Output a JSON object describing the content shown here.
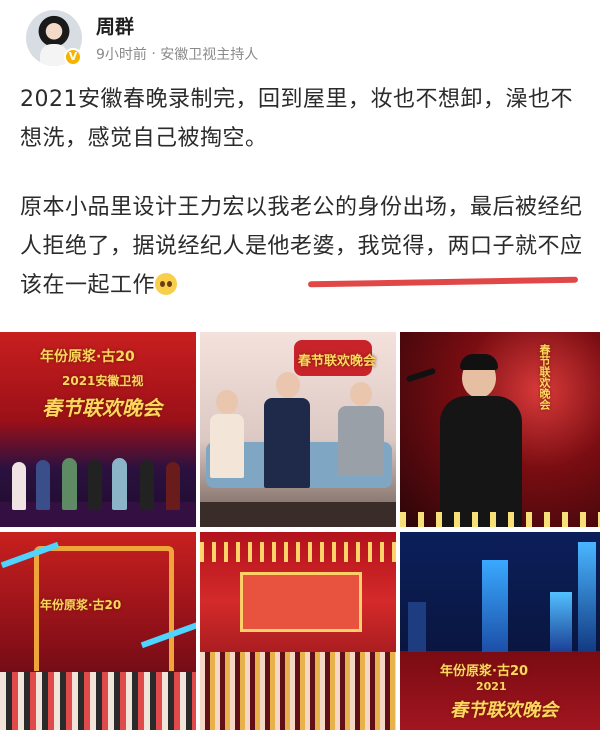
{
  "author": {
    "name": "周群",
    "time": "9小时前",
    "separator": "·",
    "source": "安徽卫视主持人",
    "verified_badge": "V"
  },
  "post": {
    "paragraph1": "2021安徽春晚录制完，回到屋里，妆也不想卸，澡也不想洗，感觉自己被掏空。",
    "paragraph2_part1": "原本小品里设计王力宏以我老公的身份出场，最后被经纪人拒绝了，",
    "paragraph2_highlight": "据说经纪人是他老婆，",
    "paragraph2_part2": "我觉得，两口子就不应该在一起工作",
    "emoji": "pleading-face-emoji"
  },
  "images": {
    "img1_caption_top": "年份原浆·古20",
    "img1_caption_mid": "2021安徽卫视",
    "img1_caption_main": "春节联欢晚会",
    "img2_caption": "春节联欢晚会",
    "img3_caption": "春节联欢晚会",
    "img4_caption": "年份原浆·古20",
    "img6_caption_top": "年份原浆·古20",
    "img6_caption_mid": "2021",
    "img6_caption_main": "春节联欢晚会"
  },
  "colors": {
    "underline": "#e04848",
    "stage_red": "#b3121c",
    "gold": "#ffd75e"
  }
}
